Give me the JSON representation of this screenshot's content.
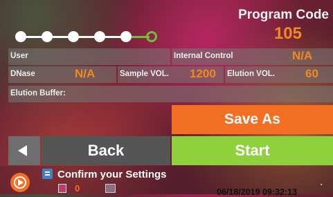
{
  "program_code": {
    "label": "Program Code",
    "value": "105"
  },
  "stepper": {
    "total_steps": 6,
    "completed_steps": 5,
    "current_step": 6
  },
  "fields": {
    "user": {
      "label": "User",
      "value": ""
    },
    "internal_control": {
      "label": "Internal Control",
      "value": "N/A"
    },
    "dnase": {
      "label": "DNase",
      "value": "N/A"
    },
    "sample_vol": {
      "label": "Sample VOL.",
      "value": "1200"
    },
    "elution_vol": {
      "label": "Elution VOL.",
      "value": "60"
    },
    "elution_buffer": {
      "label": "Elution Buffer:",
      "value": ""
    }
  },
  "buttons": {
    "save_as": "Save As",
    "back": "Back",
    "start": "Start"
  },
  "status": {
    "message": "Confirm your Settings",
    "tube_count": "0",
    "datetime": "06/18/2019 09:32:13"
  },
  "colors": {
    "accent_orange": "#f26f24",
    "value_orange": "#f08a1e",
    "start_green": "#8fd13c",
    "step_green": "#6fc13a"
  }
}
